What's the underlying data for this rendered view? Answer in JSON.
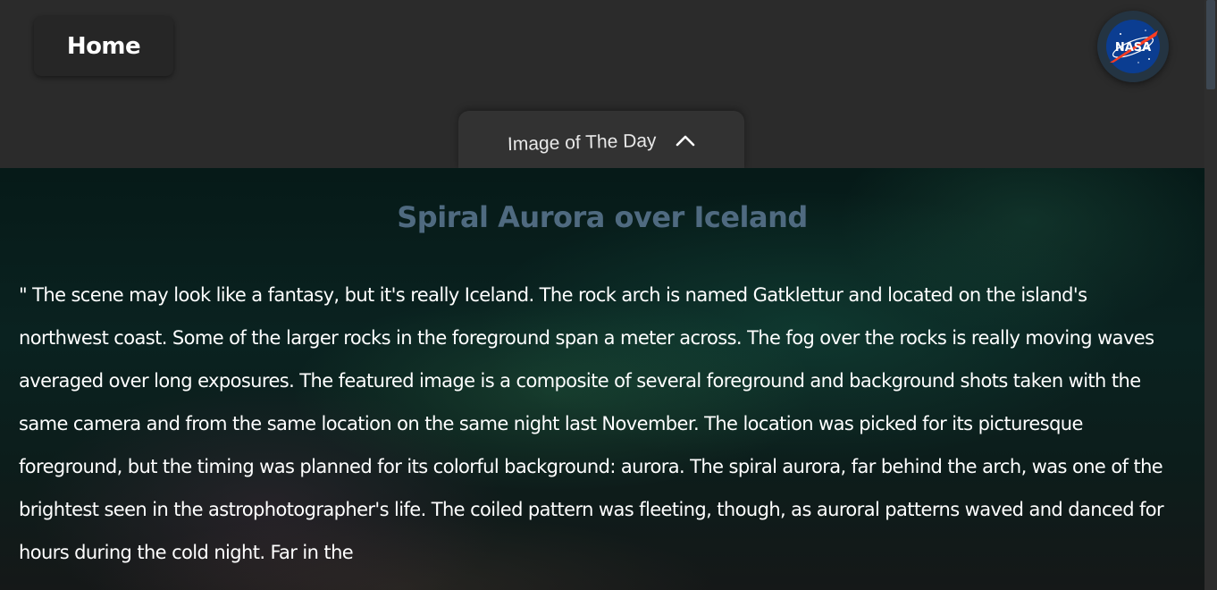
{
  "nav": {
    "home_label": "Home",
    "logo_text": "NASA",
    "logo_icon": "nasa-meatball-icon"
  },
  "tab": {
    "label": "Image of The Day",
    "icon": "chevron-up-icon",
    "expanded": true
  },
  "apod": {
    "title": "Spiral Aurora over Iceland",
    "explanation": "\" The scene may look like a fantasy, but it's really Iceland. The rock arch is named Gatklettur and located on the island's northwest coast. Some of the larger rocks in the foreground span a meter across. The fog over the rocks is really moving waves averaged over long exposures. The featured image is a composite of several foreground and background shots taken with the same camera and from the same location on the same night last November. The location was picked for its picturesque foreground, but the timing was planned for its colorful background: aurora. The spiral aurora, far behind the arch, was one of the brightest seen in the astrophotographer's life. The coiled pattern was fleeting, though, as auroral patterns waved and danced for hours during the cold night. Far in the"
  },
  "colors": {
    "header_bg": "#2b2b2b",
    "title_color": "#4f6a80",
    "text_color": "#ffffff",
    "logo_blue": "#0b3d91",
    "logo_red": "#fc3d21"
  }
}
